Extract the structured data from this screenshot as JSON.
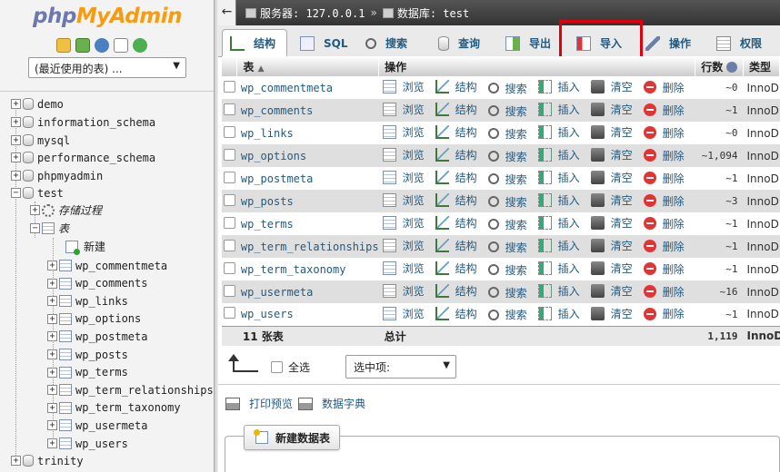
{
  "nav": {
    "logo_php": "php",
    "logo_admin": "MyAdmin",
    "recent_select": "(最近使用的表) ...",
    "databases": [
      {
        "name": "demo",
        "expanded": false
      },
      {
        "name": "information_schema",
        "expanded": false
      },
      {
        "name": "mysql",
        "expanded": false
      },
      {
        "name": "performance_schema",
        "expanded": false
      },
      {
        "name": "phpmyadmin",
        "expanded": false
      },
      {
        "name": "test",
        "expanded": true
      }
    ],
    "test_children": {
      "procedures": "存储过程",
      "tables_group": "表",
      "new_item": "新建",
      "tables": [
        "wp_commentmeta",
        "wp_comments",
        "wp_links",
        "wp_options",
        "wp_postmeta",
        "wp_posts",
        "wp_terms",
        "wp_term_relationships",
        "wp_term_taxonomy",
        "wp_usermeta",
        "wp_users"
      ]
    },
    "last_db": "trinity"
  },
  "breadcrumb": {
    "back": "←",
    "server": "服务器: 127.0.0.1",
    "sep": "»",
    "database": "数据库: test"
  },
  "tabs": [
    {
      "label": "结构",
      "icon": "structure-icon",
      "active": true
    },
    {
      "label": "SQL",
      "icon": "sql-icon",
      "active": false
    },
    {
      "label": "搜索",
      "icon": "search-icon",
      "active": false
    },
    {
      "label": "查询",
      "icon": "query-icon",
      "active": false
    },
    {
      "label": "导出",
      "icon": "export-icon",
      "active": false
    },
    {
      "label": "导入",
      "icon": "import-icon",
      "active": false
    },
    {
      "label": "操作",
      "icon": "wrench-icon",
      "active": false
    },
    {
      "label": "权限",
      "icon": "privileges-icon",
      "active": false
    }
  ],
  "table": {
    "headers": {
      "table": "表",
      "action": "操作",
      "rows": "行数",
      "type": "类型"
    },
    "actions": {
      "browse": "浏览",
      "structure": "结构",
      "search": "搜索",
      "insert": "插入",
      "empty": "清空",
      "drop": "删除"
    },
    "rows": [
      {
        "name": "wp_commentmeta",
        "rows": "~0",
        "type": "InnoDB"
      },
      {
        "name": "wp_comments",
        "rows": "~1",
        "type": "InnoDB"
      },
      {
        "name": "wp_links",
        "rows": "~0",
        "type": "InnoDB"
      },
      {
        "name": "wp_options",
        "rows": "~1,094",
        "type": "InnoDB"
      },
      {
        "name": "wp_postmeta",
        "rows": "~1",
        "type": "InnoDB"
      },
      {
        "name": "wp_posts",
        "rows": "~3",
        "type": "InnoDB"
      },
      {
        "name": "wp_terms",
        "rows": "~1",
        "type": "InnoDB"
      },
      {
        "name": "wp_term_relationships",
        "rows": "~1",
        "type": "InnoDB"
      },
      {
        "name": "wp_term_taxonomy",
        "rows": "~1",
        "type": "InnoDB"
      },
      {
        "name": "wp_usermeta",
        "rows": "~16",
        "type": "InnoDB"
      },
      {
        "name": "wp_users",
        "rows": "~1",
        "type": "InnoDB"
      }
    ],
    "footer": {
      "count": "11 张表",
      "total_label": "总计",
      "total_rows": "1,119",
      "type": "InnoDB"
    }
  },
  "bulk": {
    "select_all": "全选",
    "with_selected": "选中项:"
  },
  "links": {
    "print_preview": "打印预览",
    "data_dictionary": "数据字典"
  },
  "create_table": {
    "label": "新建数据表"
  },
  "colors": {
    "link": "#235a81",
    "highlight": "#e0000b"
  }
}
